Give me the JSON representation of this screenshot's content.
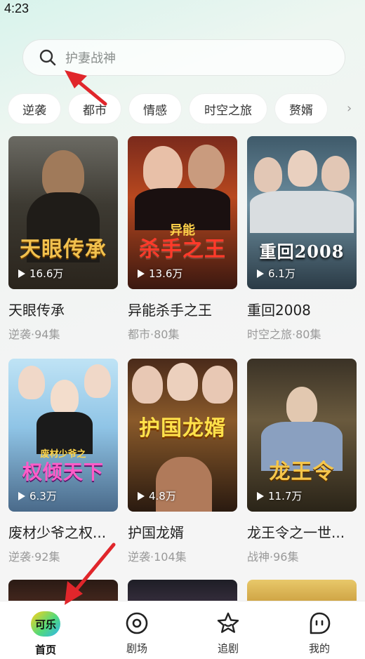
{
  "status_bar": {
    "time": "4:23"
  },
  "search": {
    "placeholder": "护妻战神"
  },
  "categories": [
    "逆袭",
    "都市",
    "情感",
    "时空之旅",
    "赘婿"
  ],
  "dramas": [
    {
      "title": "天眼传承",
      "meta": "逆袭·94集",
      "views": "16.6万",
      "poster_text": "天眼传承"
    },
    {
      "title": "异能杀手之王",
      "meta": "都市·80集",
      "views": "13.6万",
      "poster_text": "杀手之王",
      "poster_sub": "异能"
    },
    {
      "title": "重回2008",
      "meta": "时空之旅·80集",
      "views": "6.1万",
      "poster_text": "重回2008"
    },
    {
      "title": "废材少爷之权...",
      "meta": "逆袭·92集",
      "views": "6.3万",
      "poster_text": "权倾天下",
      "poster_sub": "废材少爷之"
    },
    {
      "title": "护国龙婿",
      "meta": "逆袭·104集",
      "views": "4.8万",
      "poster_text": "护国龙婿"
    },
    {
      "title": "龙王令之一世...",
      "meta": "战神·96集",
      "views": "11.7万",
      "poster_text": "龙王令"
    }
  ],
  "tabbar": {
    "logo_text": "可乐",
    "items": [
      {
        "label": "首页",
        "icon": "home-logo-icon",
        "active": true
      },
      {
        "label": "剧场",
        "icon": "theater-icon",
        "active": false
      },
      {
        "label": "追剧",
        "icon": "star-icon",
        "active": false
      },
      {
        "label": "我的",
        "icon": "profile-icon",
        "active": false
      }
    ]
  },
  "colors": {
    "accent_arrow": "#e0262b",
    "chip_bg": "#ffffff",
    "muted_text": "#999999"
  }
}
